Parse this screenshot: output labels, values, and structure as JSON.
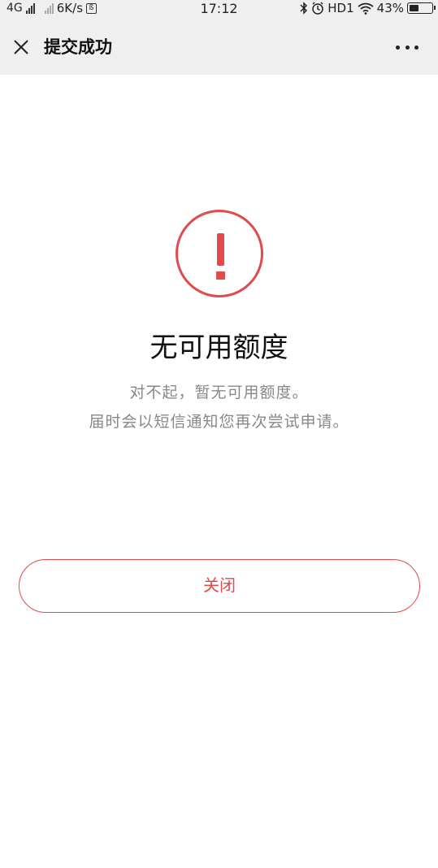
{
  "status_bar": {
    "network_type": "4G",
    "speed": "6K/s",
    "notify_box_glyph": "ß",
    "time": "17:12",
    "hd_label": "HD1",
    "battery_percent": "43%",
    "battery_level": 0.43,
    "icons": [
      "signal-icon",
      "bluetooth-icon",
      "alarm-icon",
      "wifi-icon",
      "battery-icon"
    ]
  },
  "title_bar": {
    "title": "提交成功",
    "close_icon": "close-icon",
    "more_icon": "more-icon"
  },
  "main": {
    "alert_icon": "exclamation-circle-icon",
    "headline": "无可用额度",
    "description_line1": "对不起，暂无可用额度。",
    "description_line2": "届时会以短信通知您再次尝试申请。",
    "close_button_label": "关闭"
  },
  "colors": {
    "accent": "#e04b4b",
    "header_bg": "#efefef",
    "muted_text": "#888888"
  }
}
